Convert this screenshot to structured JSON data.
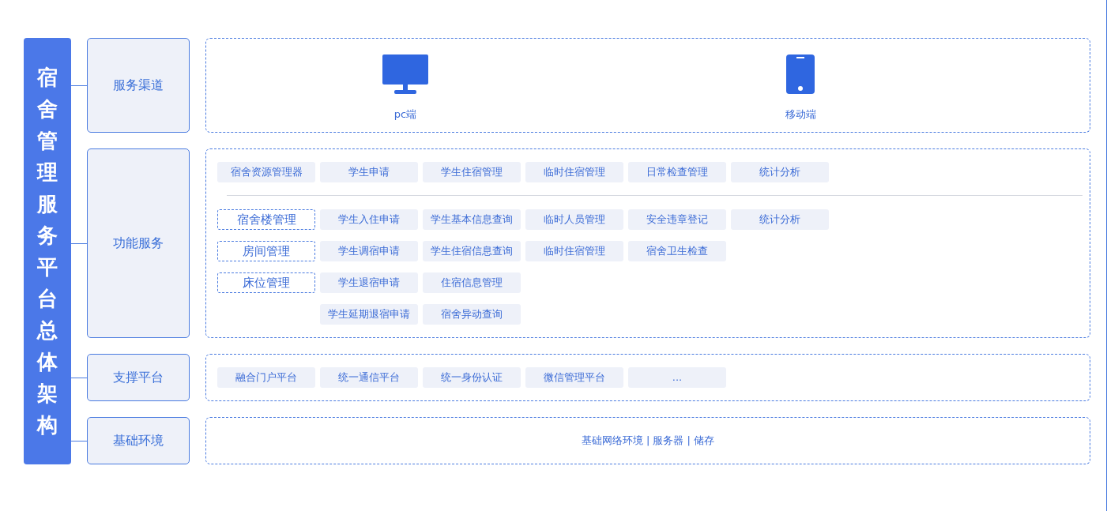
{
  "title": "宿舍管理服务平台总体架构",
  "layers": [
    {
      "label": "服务渠道",
      "kind": "channels",
      "channels": [
        {
          "label": "pc端",
          "kind": "desktop"
        },
        {
          "label": "移动端",
          "kind": "phone"
        }
      ]
    },
    {
      "label": "功能服务",
      "kind": "functions",
      "modules": [
        "宿舍资源管理器",
        "学生申请",
        "学生住宿管理",
        "临时住宿管理",
        "日常检查管理",
        "统计分析"
      ],
      "rows": [
        {
          "category": "宿舍楼管理",
          "items": [
            "学生入住申请",
            "学生基本信息查询",
            "临时人员管理",
            "安全违章登记",
            "统计分析"
          ]
        },
        {
          "category": "房间管理",
          "items": [
            "学生调宿申请",
            "学生住宿信息查询",
            "临时住宿管理",
            "宿舍卫生检查"
          ]
        },
        {
          "category": "床位管理",
          "items": [
            "学生退宿申请",
            "住宿信息管理"
          ]
        },
        {
          "items": [
            "学生延期退宿申请",
            "宿舍异动查询"
          ]
        }
      ]
    },
    {
      "label": "支撑平台",
      "kind": "chips",
      "items": [
        "融合门户平台",
        "统一通信平台",
        "统一身份认证",
        "微信管理平台",
        "..."
      ]
    },
    {
      "label": "基础环境",
      "kind": "text",
      "text": "基础网络环境 | 服务器 | 储存"
    }
  ]
}
